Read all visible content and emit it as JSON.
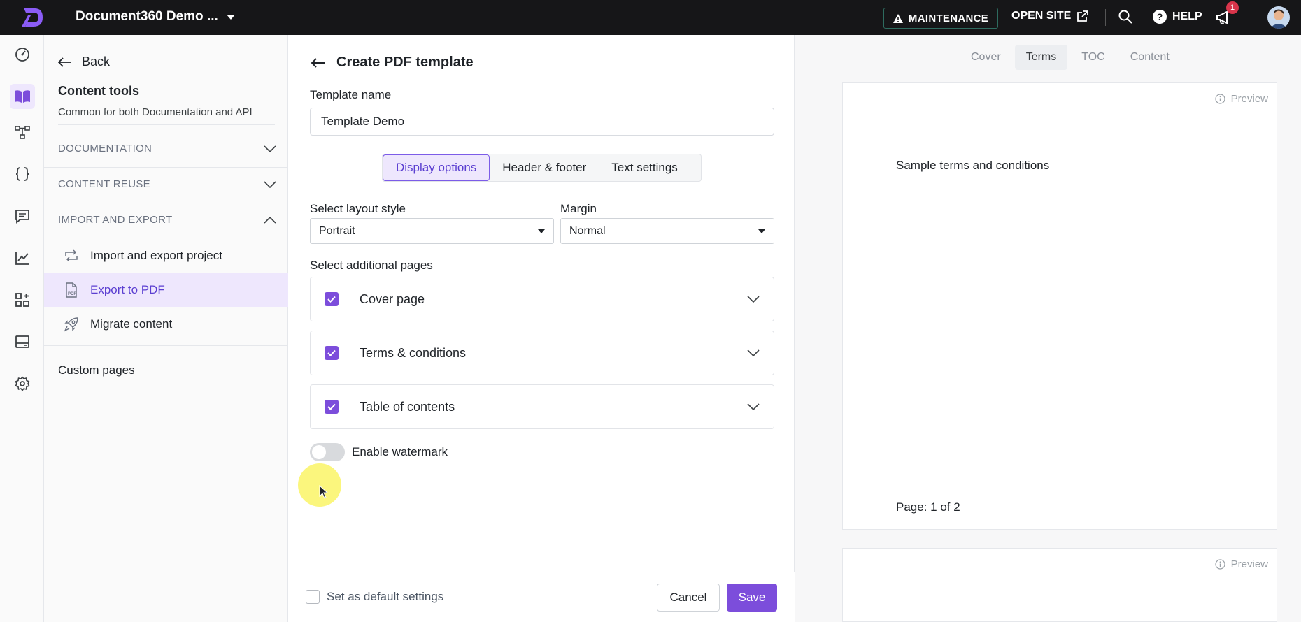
{
  "topbar": {
    "project_name": "Document360 Demo ...",
    "maintenance_label": "MAINTENANCE",
    "open_site_label": "OPEN SITE",
    "help_label": "HELP",
    "notification_count": "1"
  },
  "subnav": {
    "back_label": "Back",
    "section_title": "Content tools",
    "section_subtitle": "Common for both Documentation and API",
    "groups": [
      {
        "label": "DOCUMENTATION",
        "expanded": false
      },
      {
        "label": "CONTENT REUSE",
        "expanded": false
      },
      {
        "label": "IMPORT AND EXPORT",
        "expanded": true
      }
    ],
    "items": [
      {
        "label": "Import and export project",
        "icon": "import-export-icon"
      },
      {
        "label": "Export to PDF",
        "icon": "pdf-file-icon",
        "active": true
      },
      {
        "label": "Migrate content",
        "icon": "rocket-icon"
      }
    ],
    "custom_pages_label": "Custom pages"
  },
  "form": {
    "title": "Create PDF template",
    "template_name_label": "Template name",
    "template_name_value": "Template Demo",
    "tabs": [
      {
        "label": "Display options",
        "active": true
      },
      {
        "label": "Header & footer",
        "active": false
      },
      {
        "label": "Text settings",
        "active": false
      }
    ],
    "layout_label": "Select layout style",
    "layout_value": "Portrait",
    "margin_label": "Margin",
    "margin_value": "Normal",
    "additional_pages_label": "Select additional pages",
    "pages": [
      {
        "label": "Cover page",
        "checked": true
      },
      {
        "label": "Terms & conditions",
        "checked": true
      },
      {
        "label": "Table of contents",
        "checked": true
      }
    ],
    "watermark_label": "Enable watermark",
    "watermark_enabled": false
  },
  "footer": {
    "default_label": "Set as default settings",
    "cancel_label": "Cancel",
    "save_label": "Save"
  },
  "preview": {
    "tabs": [
      {
        "label": "Cover",
        "active": false
      },
      {
        "label": "Terms",
        "active": true
      },
      {
        "label": "TOC",
        "active": false
      },
      {
        "label": "Content",
        "active": false
      }
    ],
    "preview_label": "Preview",
    "sample_text": "Sample terms and conditions",
    "page_number": "Page: 1 of 2"
  },
  "colors": {
    "accent": "#7c4ddb",
    "accent_light": "#eee7fd",
    "topbar": "#161618"
  }
}
